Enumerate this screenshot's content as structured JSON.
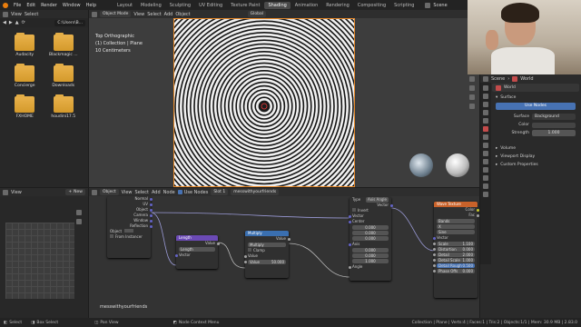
{
  "topbar": {
    "menus": [
      "File",
      "Edit",
      "Render",
      "Window",
      "Help"
    ],
    "workspaces": [
      "Layout",
      "Modeling",
      "Sculpting",
      "UV Editing",
      "Texture Paint",
      "Shading",
      "Animation",
      "Rendering",
      "Compositing",
      "Scripting"
    ],
    "active_workspace": "Shading",
    "scene_label": "Scene",
    "options_label": "Options"
  },
  "file_browser": {
    "view_label": "View",
    "select_label": "Select",
    "path": "C:\\Users\\B...",
    "folders": [
      "Audacity",
      "Blackmagic ...",
      "Concierge",
      "Downloads",
      "FXHOME",
      "houdini17.5"
    ]
  },
  "viewport": {
    "mode": "Object Mode",
    "menus": [
      "View",
      "Select",
      "Add",
      "Object"
    ],
    "orientation": "Global",
    "info_line1": "Top Orthographic",
    "info_line2": "(1) Collection | Plane",
    "info_line3": "10 Centimeters"
  },
  "image_editor": {
    "view_label": "View",
    "new_label": "New"
  },
  "node_editor": {
    "object_label": "Object",
    "menus": [
      "View",
      "Select",
      "Add",
      "Node"
    ],
    "use_nodes_label": "Use Nodes",
    "slot_label": "Slot 1",
    "material_name": "messwithyourfriends",
    "footer_material": "messwithyourfriends",
    "texcoord_outputs": [
      "Normal",
      "UV",
      "Object",
      "Camera",
      "Window",
      "Reflection"
    ],
    "texcoord_object_label": "Object",
    "from_instancer_label": "From Instancer",
    "length_node": {
      "title": "Length",
      "output": "Value",
      "op": "Length",
      "input": "Vector"
    },
    "multiply_node": {
      "title": "Multiply",
      "output": "Value",
      "op": "Multiply",
      "clamp": "Clamp",
      "input1": "Value",
      "input2_label": "Value",
      "input2_value": "50.000"
    },
    "mapping_node": {
      "type_label": "Type",
      "type_value": "Axis Angle",
      "output": "Vector",
      "invert": "Invert",
      "vector": "Vector",
      "center": "Center",
      "center_vals": [
        "0.000",
        "0.000",
        "0.000"
      ],
      "axis": "Axis",
      "axis_vals": [
        "0.000",
        "0.000",
        "1.000"
      ],
      "angle": "Angle"
    },
    "wave_node": {
      "title": "Wave Texture",
      "outputs": [
        "Color",
        "Fac"
      ],
      "wave_type": "Bands",
      "direction": "X",
      "profile": "Sine",
      "vector": "Vector",
      "fields": [
        {
          "label": "Scale",
          "value": "1.100"
        },
        {
          "label": "Distortion",
          "value": "0.000"
        },
        {
          "label": "Detail",
          "value": "2.000"
        },
        {
          "label": "Detail Scale",
          "value": "1.000"
        },
        {
          "label": "Detail Rough",
          "value": "0.500"
        },
        {
          "label": "Phase Offs",
          "value": "0.000"
        }
      ]
    }
  },
  "properties": {
    "scene_label": "Scene",
    "world_label": "World",
    "world_name": "World",
    "surface_header": "Surface",
    "use_nodes_button": "Use Nodes",
    "surface_label": "Surface",
    "surface_value": "Background",
    "color_label": "Color",
    "strength_label": "Strength",
    "strength_value": "1.000",
    "sections": [
      "Volume",
      "Viewport Display",
      "Custom Properties"
    ]
  },
  "statusbar": {
    "left1": "Select",
    "left2": "Box Select",
    "left3": "Pan View",
    "center": "Node Context Menu",
    "stats": "Collection | Plane | Verts:4 | Faces:1 | Tris:2 | Objects:1/1 | Mem: 30.9 MB | 2.83.0"
  },
  "colors": {
    "accent": "#4772b3",
    "active_tab": "#4a4a4a",
    "folder": "#e2a83f",
    "node_length": "#6b4ab5",
    "node_multiply": "#3a6fb0",
    "node_wave": "#c9622a"
  }
}
